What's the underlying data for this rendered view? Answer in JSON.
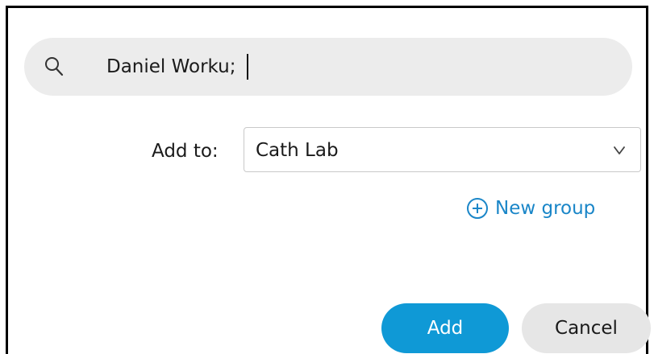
{
  "search": {
    "value": "Daniel Worku;",
    "icon": "search-icon"
  },
  "add_to": {
    "label": "Add to:",
    "selected": "Cath Lab",
    "icon": "chevron-down-icon"
  },
  "new_group": {
    "label": "New group",
    "icon": "plus-circle-icon"
  },
  "buttons": {
    "add_label": "Add",
    "cancel_label": "Cancel"
  },
  "colors": {
    "accent": "#0f99d6",
    "link": "#1a86c8",
    "search_bg": "#ececec",
    "cancel_bg": "#e6e6e6"
  }
}
